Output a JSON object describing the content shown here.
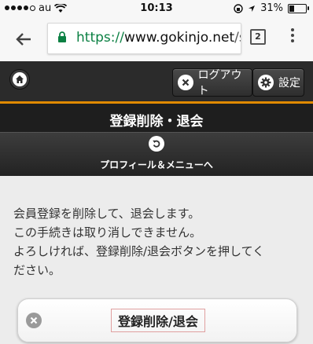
{
  "status_bar": {
    "carrier": "au",
    "time": "10:13",
    "battery": "31%",
    "battery_level": 0.31
  },
  "browser": {
    "url_scheme": "https://",
    "url_host": "www.gokinjo.net",
    "url_rest": "/s",
    "tab_count": "2",
    "icons": {
      "back": "back-arrow-icon",
      "lock": "lock-icon",
      "menu": "kebab-menu-icon"
    }
  },
  "header": {
    "logout_label": "ログアウト",
    "settings_label": "設定",
    "accent_color": "#e08a00",
    "icons": {
      "home": "home-icon",
      "logout": "close-icon",
      "settings": "gear-icon"
    }
  },
  "page": {
    "title": "登録削除・退会",
    "profile_link_label": "プロフィール＆メニューへ",
    "message_lines": [
      "会員登録を削除して、退会します。",
      "この手続きは取り消しできません。",
      "よろしければ、登録削除/退会ボタンを押してく",
      "ださい。"
    ],
    "delete_button_label": "登録削除/退会"
  }
}
